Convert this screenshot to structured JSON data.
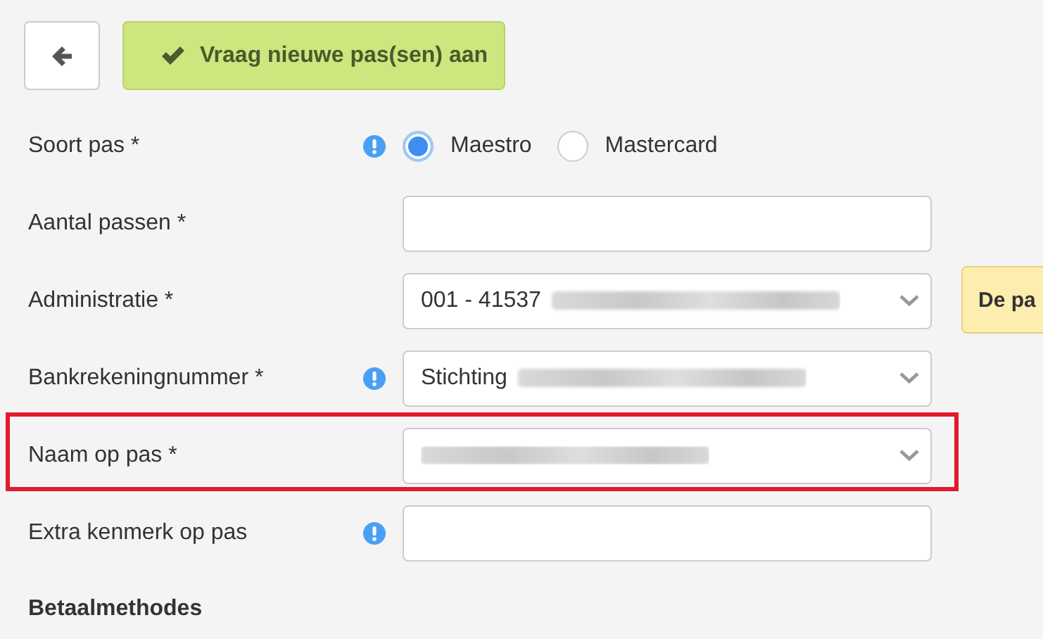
{
  "toolbar": {
    "back_button": {
      "kind": "back"
    },
    "submit_button": {
      "label": "Vraag nieuwe pas(sen) aan"
    }
  },
  "fields": [
    {
      "kind": "radio",
      "label": "Soort pas *",
      "info": true,
      "options": [
        {
          "label": "Maestro",
          "selected": true
        },
        {
          "label": "Mastercard",
          "selected": false
        }
      ]
    },
    {
      "kind": "text",
      "label": "Aantal passen *",
      "info": false
    },
    {
      "kind": "select",
      "label": "Administratie *",
      "info": false,
      "value": "001 - 41537",
      "redacted": true,
      "tooltip": "De pa"
    },
    {
      "kind": "select",
      "label": "Bankrekeningnummer *",
      "info": true,
      "value": "Stichting",
      "redacted": true
    },
    {
      "kind": "select",
      "label": "Naam op pas *",
      "info": false,
      "redacted": true,
      "highlighted": true
    },
    {
      "kind": "text",
      "label": "Extra kenmerk op pas",
      "info": true
    }
  ],
  "section_heading": "Betaalmethodes"
}
